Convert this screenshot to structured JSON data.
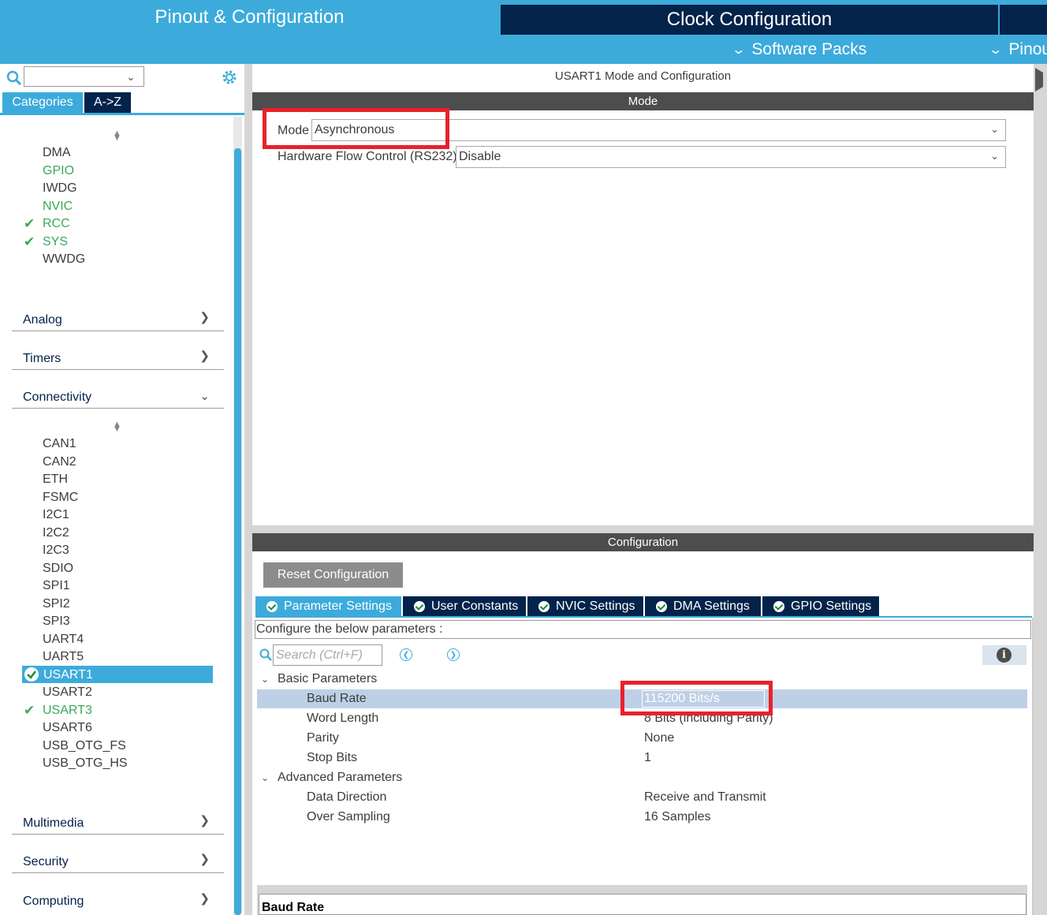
{
  "top_tabs": {
    "pinout": "Pinout & Configuration",
    "clock": "Clock Configuration"
  },
  "sub_menu": {
    "software_packs": "Software Packs",
    "pinout": "Pinout"
  },
  "left_panel": {
    "view_buttons": {
      "categories": "Categories",
      "atoz": "A->Z"
    },
    "system_core_items": [
      {
        "label": "DMA",
        "state": "normal"
      },
      {
        "label": "GPIO",
        "state": "green"
      },
      {
        "label": "IWDG",
        "state": "normal"
      },
      {
        "label": "NVIC",
        "state": "green"
      },
      {
        "label": "RCC",
        "state": "checked"
      },
      {
        "label": "SYS",
        "state": "checked"
      },
      {
        "label": "WWDG",
        "state": "normal"
      }
    ],
    "categories": {
      "analog": "Analog",
      "timers": "Timers",
      "connectivity": "Connectivity",
      "multimedia": "Multimedia",
      "security": "Security",
      "computing": "Computing"
    },
    "connectivity_items": [
      {
        "label": "CAN1",
        "state": "normal"
      },
      {
        "label": "CAN2",
        "state": "normal"
      },
      {
        "label": "ETH",
        "state": "normal"
      },
      {
        "label": "FSMC",
        "state": "normal"
      },
      {
        "label": "I2C1",
        "state": "normal"
      },
      {
        "label": "I2C2",
        "state": "normal"
      },
      {
        "label": "I2C3",
        "state": "normal"
      },
      {
        "label": "SDIO",
        "state": "normal"
      },
      {
        "label": "SPI1",
        "state": "normal"
      },
      {
        "label": "SPI2",
        "state": "normal"
      },
      {
        "label": "SPI3",
        "state": "normal"
      },
      {
        "label": "UART4",
        "state": "normal"
      },
      {
        "label": "UART5",
        "state": "normal"
      },
      {
        "label": "USART1",
        "state": "selected"
      },
      {
        "label": "USART2",
        "state": "normal"
      },
      {
        "label": "USART3",
        "state": "checked"
      },
      {
        "label": "USART6",
        "state": "normal"
      },
      {
        "label": "USB_OTG_FS",
        "state": "normal"
      },
      {
        "label": "USB_OTG_HS",
        "state": "normal"
      }
    ]
  },
  "mode_panel": {
    "title": "USART1 Mode and Configuration",
    "section": "Mode",
    "mode_label": "Mode",
    "mode_value": "Asynchronous",
    "flow_label": "Hardware Flow Control (RS232)",
    "flow_value": "Disable"
  },
  "config_panel": {
    "section": "Configuration",
    "reset_button": "Reset Configuration",
    "tabs": [
      "Parameter Settings",
      "User Constants",
      "NVIC Settings",
      "DMA Settings",
      "GPIO Settings"
    ],
    "note": "Configure the below parameters :",
    "search_placeholder": "Search (Ctrl+F)",
    "groups": {
      "basic": "Basic Parameters",
      "advanced": "Advanced Parameters"
    },
    "params": {
      "baud_rate": {
        "name": "Baud Rate",
        "value": "115200 Bits/s"
      },
      "word_length": {
        "name": "Word Length",
        "value": "8 Bits (including Parity)"
      },
      "parity": {
        "name": "Parity",
        "value": "None"
      },
      "stop_bits": {
        "name": "Stop Bits",
        "value": "1"
      },
      "data_direction": {
        "name": "Data Direction",
        "value": "Receive and Transmit"
      },
      "over_sampling": {
        "name": "Over Sampling",
        "value": "16 Samples"
      }
    },
    "description_title": "Baud Rate"
  },
  "colors": {
    "brand_blue": "#3cabdb",
    "navy": "#03234b",
    "active_green": "#3aa85a",
    "highlight_red": "#e8212c",
    "section_gray": "#4d4d4d"
  },
  "icons": [
    "search-icon",
    "gear-icon",
    "chevron-down-icon",
    "chevron-right-icon",
    "check-icon",
    "info-icon",
    "prev-icon",
    "next-icon"
  ]
}
